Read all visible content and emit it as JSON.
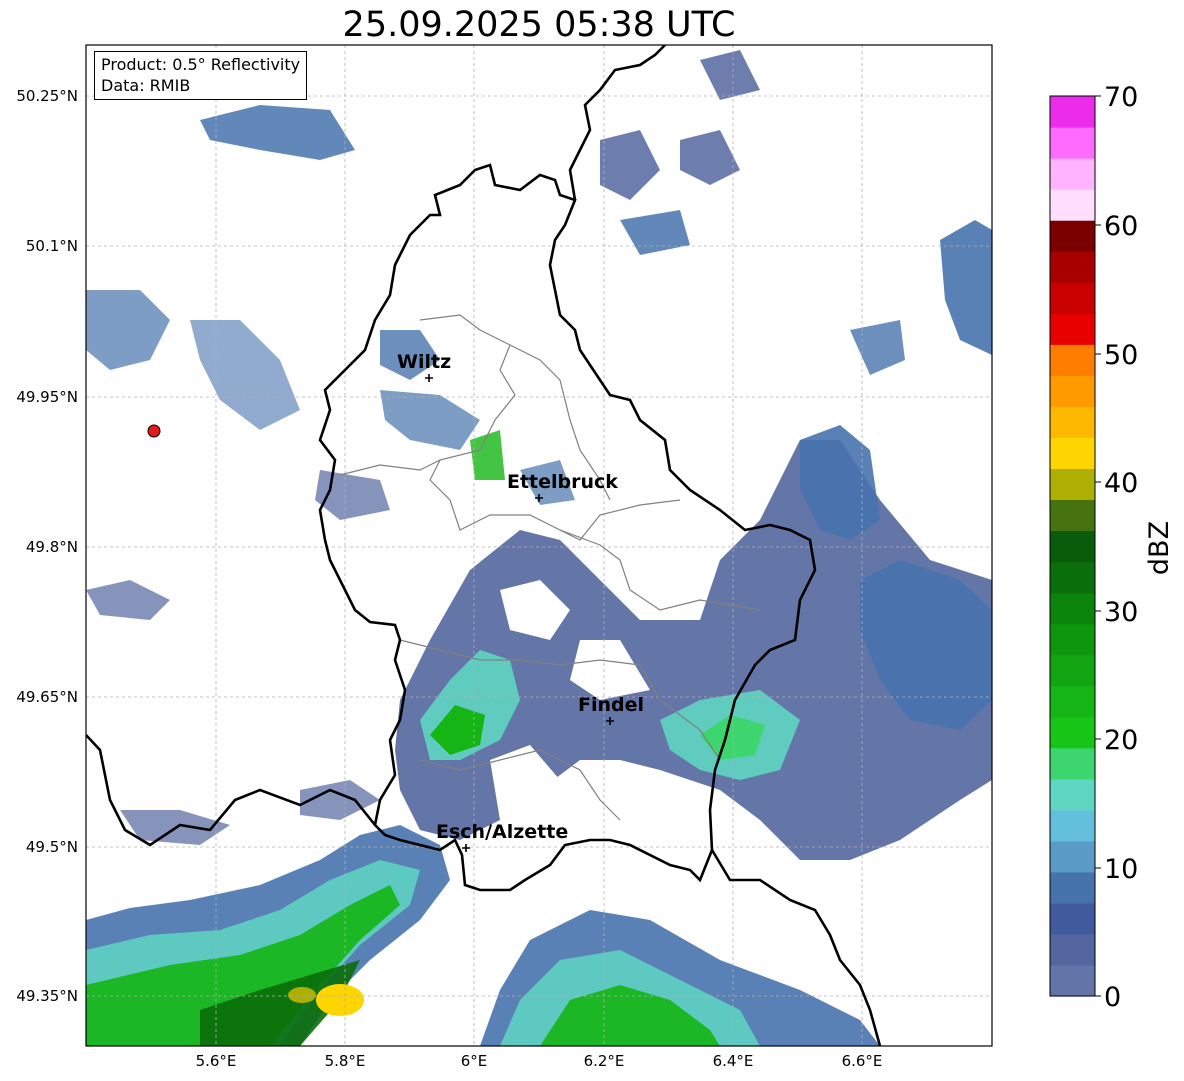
{
  "title": "25.09.2025 05:38 UTC",
  "info": {
    "product": "Product: 0.5° Reflectivity",
    "data_source": "Data: RMIB"
  },
  "lat_ticks": [
    "50.25°N",
    "50.1°N",
    "49.95°N",
    "49.8°N",
    "49.65°N",
    "49.5°N",
    "49.35°N"
  ],
  "lon_ticks": [
    "5.6°E",
    "5.8°E",
    "6°E",
    "6.2°E",
    "6.4°E",
    "6.6°E"
  ],
  "cities": [
    {
      "name": "Wiltz"
    },
    {
      "name": "Ettelbruck"
    },
    {
      "name": "Findel"
    },
    {
      "name": "Esch/Alzette"
    }
  ],
  "colorbar": {
    "label": "dBZ",
    "ticks": [
      "0",
      "10",
      "20",
      "30",
      "40",
      "50",
      "60",
      "70"
    ],
    "colors": [
      "#6374a8",
      "#53669f",
      "#415a9e",
      "#4773ad",
      "#5a9bc8",
      "#63c0dc",
      "#5fd6c2",
      "#3dd56d",
      "#16c516",
      "#14b514",
      "#11a611",
      "#0f960f",
      "#0b840b",
      "#0a6e0a",
      "#0a5b0a",
      "#467210",
      "#adb003",
      "#ffd500",
      "#ffb800",
      "#ff9a00",
      "#ff7d00",
      "#e80000",
      "#c80000",
      "#a80000",
      "#7a0000",
      "#ffdeff",
      "#ffb4ff",
      "#ff6bff",
      "#eb2deb"
    ]
  },
  "radar_site_color": "#e31a1c"
}
